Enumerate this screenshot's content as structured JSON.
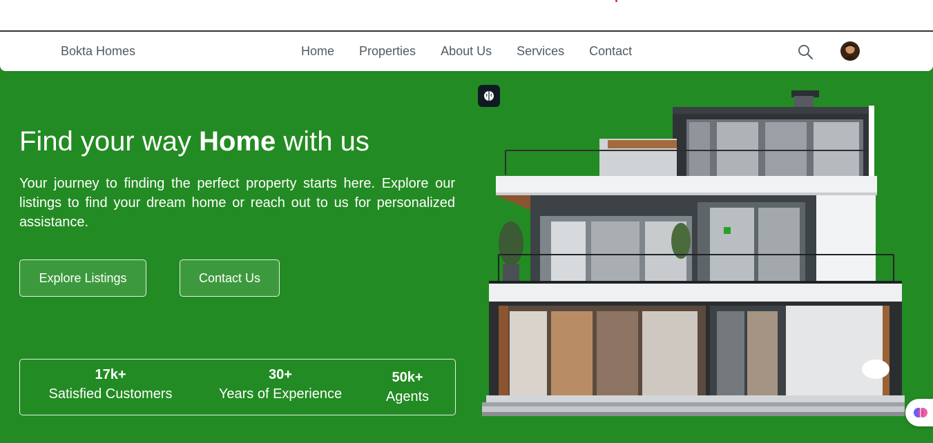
{
  "navbar": {
    "brand": "Bokta Homes",
    "links": [
      "Home",
      "Properties",
      "About Us",
      "Services",
      "Contact"
    ],
    "search_icon": "search-icon",
    "avatar_icon": "user-avatar"
  },
  "hero": {
    "background_color": "#238b23",
    "headline_pre": "Find your way ",
    "headline_bold": "Home",
    "headline_post": " with us",
    "subtext": "Your journey to finding the perfect property starts here. Explore our listings to find your dream home or reach out to us for personalized assistance.",
    "buttons": {
      "explore": "Explore Listings",
      "contact": "Contact Us"
    },
    "stats": [
      {
        "value": "17k+",
        "label": "Satisfied Customers"
      },
      {
        "value": "30+",
        "label": "Years of Experience"
      },
      {
        "value": "50k+",
        "label": "Agents"
      }
    ],
    "image_icon": "modern-house-image",
    "badge_icon": "brain-icon"
  },
  "widget": {
    "icon": "brain-icon"
  }
}
